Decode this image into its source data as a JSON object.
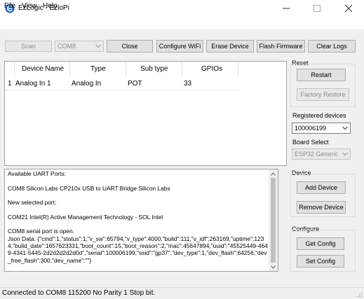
{
  "window": {
    "title": "EzLogic - EzloPi",
    "minimize_icon": "minimize-icon",
    "maximize_icon": "maximize-icon",
    "close_icon": "close-icon"
  },
  "menu": {
    "items": [
      "File",
      "View",
      "Help"
    ]
  },
  "toolbar": {
    "scan_label": "Scan",
    "port_value": "COM8",
    "close_label": "Close",
    "configure_wifi_label": "Configure WiFi",
    "erase_device_label": "Erase Device",
    "flash_firmware_label": "Flash Firmware",
    "clear_logs_label": "Clear Logs"
  },
  "device_table": {
    "columns": [
      "Device Name",
      "Type",
      "Sub type",
      "GPIOs"
    ],
    "rows": [
      {
        "index": "1",
        "device_name": "Analog In 1",
        "type": "Analog In",
        "sub_type": "POT",
        "gpios": "33"
      }
    ]
  },
  "log": {
    "text": "Available UART Ports:\n\nCOM8 Silicon Labs CP210x USB to UART Bridge Silicon Labs\n\nNew selected port:\n\nCOM21 Intel(R) Active Management Technology - SOL Intel\n\nCOM8 serial port is open.\nJson Data: {\"cmd\":1,\"status\":1,\"v_sw\":65794,\"v_type\":4000,\"build\":111,\"v_idf\":263169,\"uptime\":1234,\"build_date\":1657623331,\"boot_count\":15,\"boot_reason\":2,\"mac\":45647894,\"uuid\":\"45525449-4649-4341-5445-2d2d2d2d2d0d\",\"serial\":100006199,\"ssid\":\"gp37\",\"dev_type\":1,\"dev_flash\":64256,\"dev_free_flash\":300,\"dev_name\":\"\"}"
  },
  "reset": {
    "label": "Reset",
    "restart_label": "Restart",
    "factory_restore_label": "Factory Restore"
  },
  "registered_devices": {
    "label": "Registered devices",
    "value": "100006199"
  },
  "board_select": {
    "label": "Board Select",
    "value": "ESP32 Generic"
  },
  "device": {
    "label": "Device",
    "add_label": "Add Device",
    "remove_label": "Remove Device"
  },
  "configure": {
    "label": "Configure",
    "get_label": "Get Config",
    "set_label": "Set Config"
  },
  "status": {
    "text": "Connected to COM8 115200 No Parity 1 Stop bit."
  },
  "colors": {
    "accent": "#1f5fbf",
    "window_bg": "#f0f0f0",
    "button_bg": "#e1e1e1"
  }
}
